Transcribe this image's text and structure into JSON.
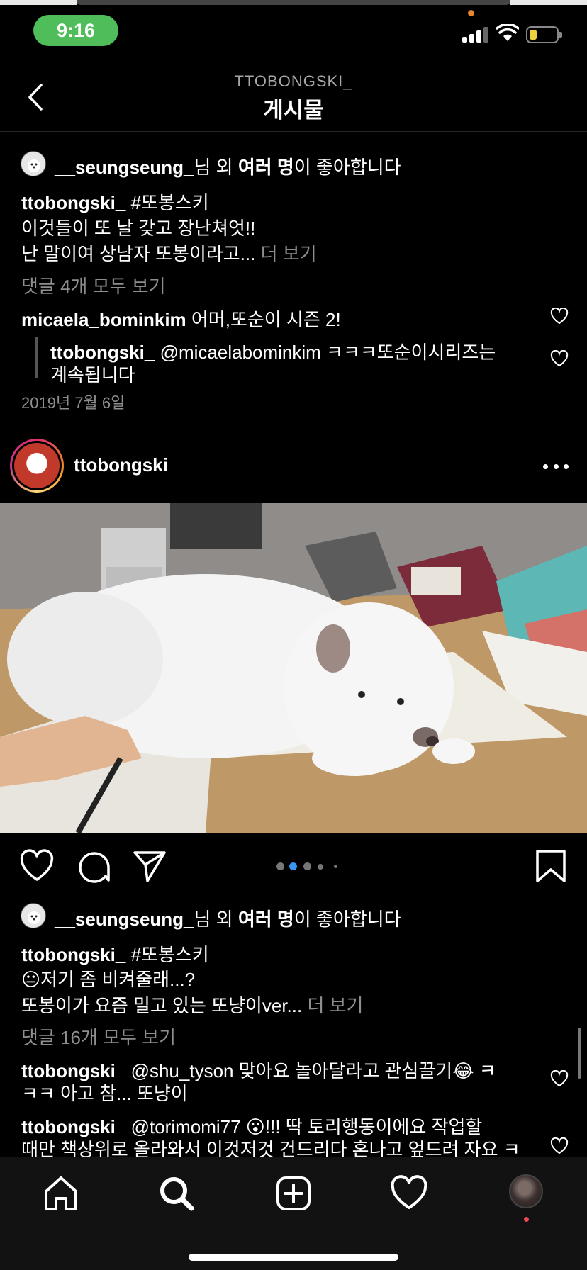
{
  "status_bar": {
    "time": "9:16"
  },
  "header": {
    "username": "TTOBONGSKI_",
    "title": "게시물"
  },
  "post1": {
    "likes": {
      "liker": "__seungseung_",
      "suffix_a": "님 외 ",
      "bold": "여러 명",
      "suffix_b": "이 좋아합니다"
    },
    "caption": {
      "author": "ttobongski_",
      "hashtag": "#또봉스키",
      "line1": "이것들이 또 날 갖고 장난쳐엇!!",
      "line2": "난 말이여 상남자 또봉이라고...",
      "more": "더 보기"
    },
    "view_comments": "댓글 4개 모두 보기",
    "comments": [
      {
        "author": "micaela_bominkim",
        "text": "어머,또순이 시즌 2!"
      },
      {
        "author": "ttobongski_",
        "text_line1": "@micaelabominkim ㅋㅋㅋ또순이시리즈는",
        "text_line2": "계속됩니다"
      }
    ],
    "date": "2019년 7월 6일"
  },
  "post2": {
    "username": "ttobongski_",
    "carousel": {
      "total": 5,
      "active": 2
    },
    "likes": {
      "liker": "__seungseung_",
      "suffix_a": "님 외 ",
      "bold": "여러 명",
      "suffix_b": "이 좋아합니다"
    },
    "caption": {
      "author": "ttobongski_",
      "hashtag": "#또봉스키",
      "emoji1": "😐",
      "line1": "저기 좀 비켜줄래...?",
      "line2": "또봉이가 요즘 밀고 있는 또냥이ver...",
      "more": "더 보기"
    },
    "view_comments": "댓글 16개 모두 보기",
    "comments": [
      {
        "author": "ttobongski_",
        "text_line1": "@shu_tyson 맞아요 놀아달라고 관심끌기😂 ㅋ",
        "text_line2": "ㅋㅋ 아고 참... 또냥이"
      },
      {
        "author": "ttobongski_",
        "text_line1": "@torimomi77 😮!!! 딱 토리행동이에요 작업할",
        "text_line2": "때만 책상위로 올라와서 이것저것 건드리다 혼나고 엎드려 자요 ㅋ"
      }
    ]
  },
  "icons": {
    "back": "chevron-left-icon",
    "more": "more-horizontal-icon",
    "like": "heart-icon",
    "comment": "comment-icon",
    "share": "paper-plane-icon",
    "save": "bookmark-icon",
    "home": "home-icon",
    "search": "search-icon",
    "create": "plus-square-icon",
    "activity": "heart-icon"
  },
  "colors": {
    "background": "#000000",
    "muted_text": "#8e8e8e",
    "carousel_active": "#3897f0",
    "time_pill": "#4fbe5a",
    "notification": "#ed4956"
  }
}
